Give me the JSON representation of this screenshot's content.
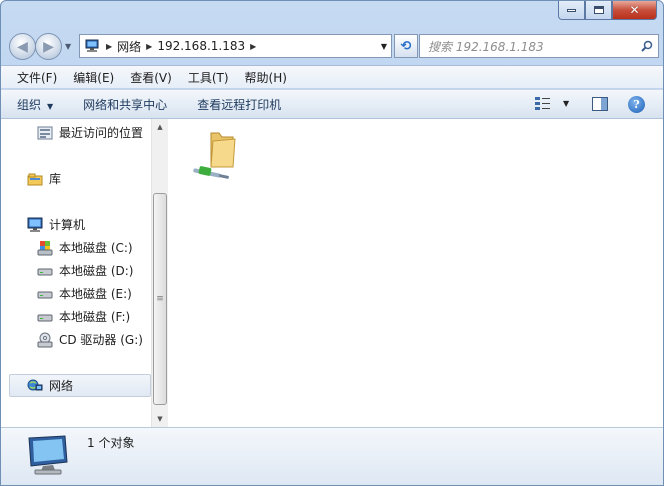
{
  "window": {
    "title": "",
    "caption_icons": [
      "minimize-icon",
      "maximize-icon",
      "close-icon"
    ]
  },
  "nav": {
    "breadcrumbs": [
      "网络",
      "192.168.1.183"
    ],
    "search_placeholder": "搜索 192.168.1.183"
  },
  "menu": {
    "items": [
      "文件(F)",
      "编辑(E)",
      "查看(V)",
      "工具(T)",
      "帮助(H)"
    ]
  },
  "commands": {
    "organize": "组织",
    "network_center": "网络和共享中心",
    "remote_printers": "查看远程打印机"
  },
  "sidebar": {
    "items": [
      {
        "label": "最近访问的位置",
        "icon": "recent-places-icon"
      },
      {
        "label": "库",
        "icon": "library-icon"
      },
      {
        "label": "计算机",
        "icon": "computer-icon"
      },
      {
        "label": "本地磁盘 (C:)",
        "icon": "system-drive-icon"
      },
      {
        "label": "本地磁盘 (D:)",
        "icon": "drive-icon"
      },
      {
        "label": "本地磁盘 (E:)",
        "icon": "drive-icon"
      },
      {
        "label": "本地磁盘 (F:)",
        "icon": "drive-icon"
      },
      {
        "label": "CD 驱动器 (G:)",
        "icon": "cd-drive-icon"
      },
      {
        "label": "网络",
        "icon": "network-icon"
      }
    ]
  },
  "content": {
    "items": [
      {
        "label": "",
        "icon": "shared-folder-icon"
      }
    ]
  },
  "details": {
    "count_text": "1 个对象"
  },
  "colors": {
    "frame": "#b9d1ee",
    "command_text": "#1e3a5e",
    "accent": "#1b5fb7"
  }
}
